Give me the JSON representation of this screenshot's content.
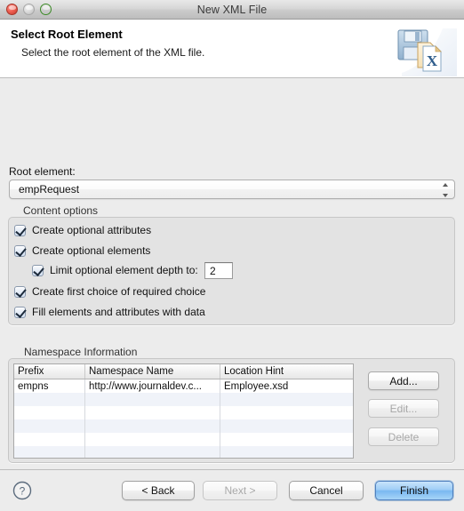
{
  "window": {
    "title": "New XML File",
    "controls": [
      "close-button",
      "minimize-button",
      "zoom-button"
    ]
  },
  "header": {
    "title": "Select Root Element",
    "subtitle": "Select the root element of the XML file.",
    "icon": "xml-file-save-icon"
  },
  "form": {
    "root_element_label": "Root element:",
    "root_element_value": "empRequest"
  },
  "content_options": {
    "group_label": "Content options",
    "items": [
      {
        "label": "Create optional attributes",
        "checked": true,
        "indent": false
      },
      {
        "label": "Create optional elements",
        "checked": true,
        "indent": false
      },
      {
        "label": "Limit optional element depth to:",
        "checked": true,
        "indent": true
      },
      {
        "label": "Create first choice of required choice",
        "checked": true,
        "indent": false
      },
      {
        "label": "Fill elements and attributes with data",
        "checked": true,
        "indent": false
      }
    ],
    "depth_value": "2"
  },
  "namespace": {
    "group_label": "Namespace Information",
    "columns": [
      "Prefix",
      "Namespace Name",
      "Location Hint"
    ],
    "rows": [
      [
        "empns",
        "http://www.journaldev.c...",
        "Employee.xsd"
      ]
    ],
    "empty_row_count": 6,
    "buttons": [
      {
        "label": "Add...",
        "enabled": true
      },
      {
        "label": "Edit...",
        "enabled": false
      },
      {
        "label": "Delete",
        "enabled": false
      }
    ]
  },
  "footer": {
    "help_label": "?",
    "buttons": [
      {
        "label": "< Back",
        "enabled": true,
        "default": false
      },
      {
        "label": "Next >",
        "enabled": false,
        "default": false
      },
      {
        "label": "Cancel",
        "enabled": true,
        "default": false
      },
      {
        "label": "Finish",
        "enabled": true,
        "default": true
      }
    ]
  },
  "colors": {
    "window_bg": "#ececec",
    "header_bg": "#ffffff",
    "group_bg": "#e3e3e3",
    "default_button_blue": "#7ab8f1",
    "row_stripe": "#f0f3f9"
  }
}
